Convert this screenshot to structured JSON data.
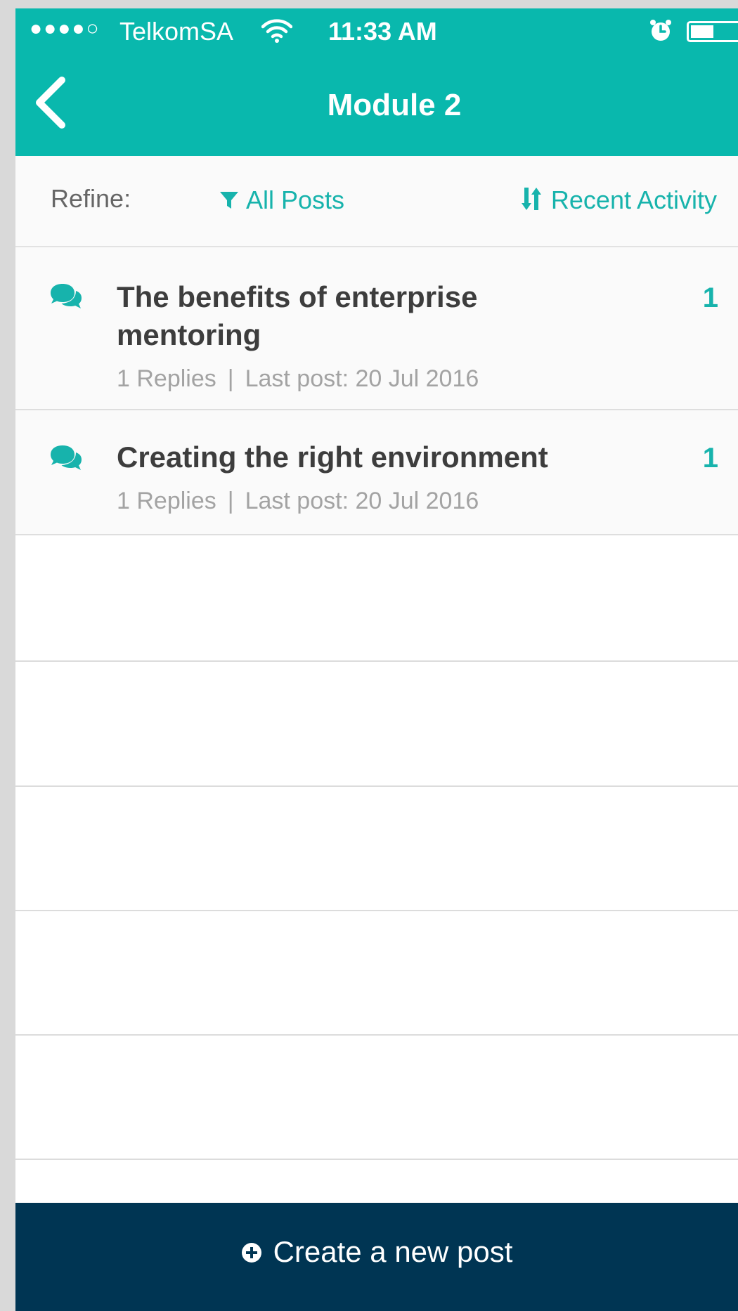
{
  "status_bar": {
    "signal": "●●●●○",
    "carrier": "TelkomSA",
    "time": "11:33 AM",
    "icons": [
      "wifi-icon",
      "alarm-icon",
      "battery-icon"
    ]
  },
  "nav": {
    "title": "Module 2",
    "back_icon": "chevron-left-icon"
  },
  "refine": {
    "label": "Refine:",
    "filter_label": "All Posts",
    "filter_icon": "filter-icon",
    "sort_label": "Recent Activity",
    "sort_icon": "sort-icon"
  },
  "posts": [
    {
      "title": "The benefits of enterprise mentoring",
      "replies": "1 Replies",
      "separator": "|",
      "last_post": "Last post: 20 Jul 2016",
      "count": "1",
      "icon": "comments-icon"
    },
    {
      "title": "Creating the right environment",
      "replies": "1 Replies",
      "separator": "|",
      "last_post": "Last post: 20 Jul 2016",
      "count": "1",
      "icon": "comments-icon"
    }
  ],
  "footer": {
    "create_label": "Create a new post",
    "create_icon": "plus-circle-icon"
  },
  "colors": {
    "header": "#09b8ad",
    "accent": "#17b3ac",
    "footer": "#003553",
    "title_text": "#3d3d3d",
    "meta_text": "#a3a3a3"
  }
}
